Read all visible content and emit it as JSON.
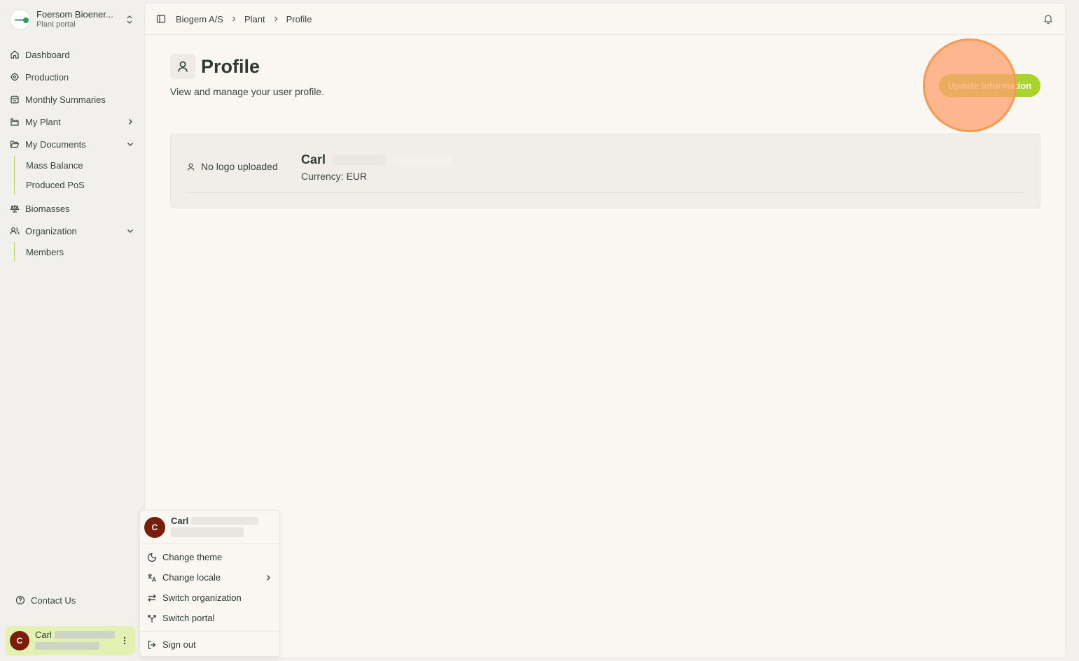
{
  "sidebar": {
    "org": {
      "name": "Foersom Bioener...",
      "subtitle": "Plant portal"
    },
    "nav": {
      "dashboard": "Dashboard",
      "production": "Production",
      "monthly_summaries": "Monthly Summaries",
      "my_plant": "My Plant",
      "my_documents": "My Documents",
      "mass_balance": "Mass Balance",
      "produced_pos": "Produced PoS",
      "biomasses": "Biomasses",
      "organization": "Organization",
      "members": "Members"
    },
    "contact": "Contact Us",
    "user": {
      "initial": "C",
      "name": "Carl"
    }
  },
  "topbar": {
    "breadcrumbs": [
      "Biogem A/S",
      "Plant",
      "Profile"
    ]
  },
  "page": {
    "title": "Profile",
    "subtitle": "View and manage your user profile.",
    "update_button": "Update Information"
  },
  "profile_card": {
    "no_logo": "No logo uploaded",
    "name": "Carl",
    "currency": "Currency: EUR"
  },
  "user_menu": {
    "initial": "C",
    "name": "Carl",
    "items": {
      "change_theme": "Change theme",
      "change_locale": "Change locale",
      "switch_organization": "Switch organization",
      "switch_portal": "Switch portal",
      "sign_out": "Sign out"
    }
  },
  "colors": {
    "accent": "#a9d42c",
    "user_card_bg": "#e3f1b2",
    "avatar": "#7a1e0b",
    "highlight": "#f79a4f"
  }
}
